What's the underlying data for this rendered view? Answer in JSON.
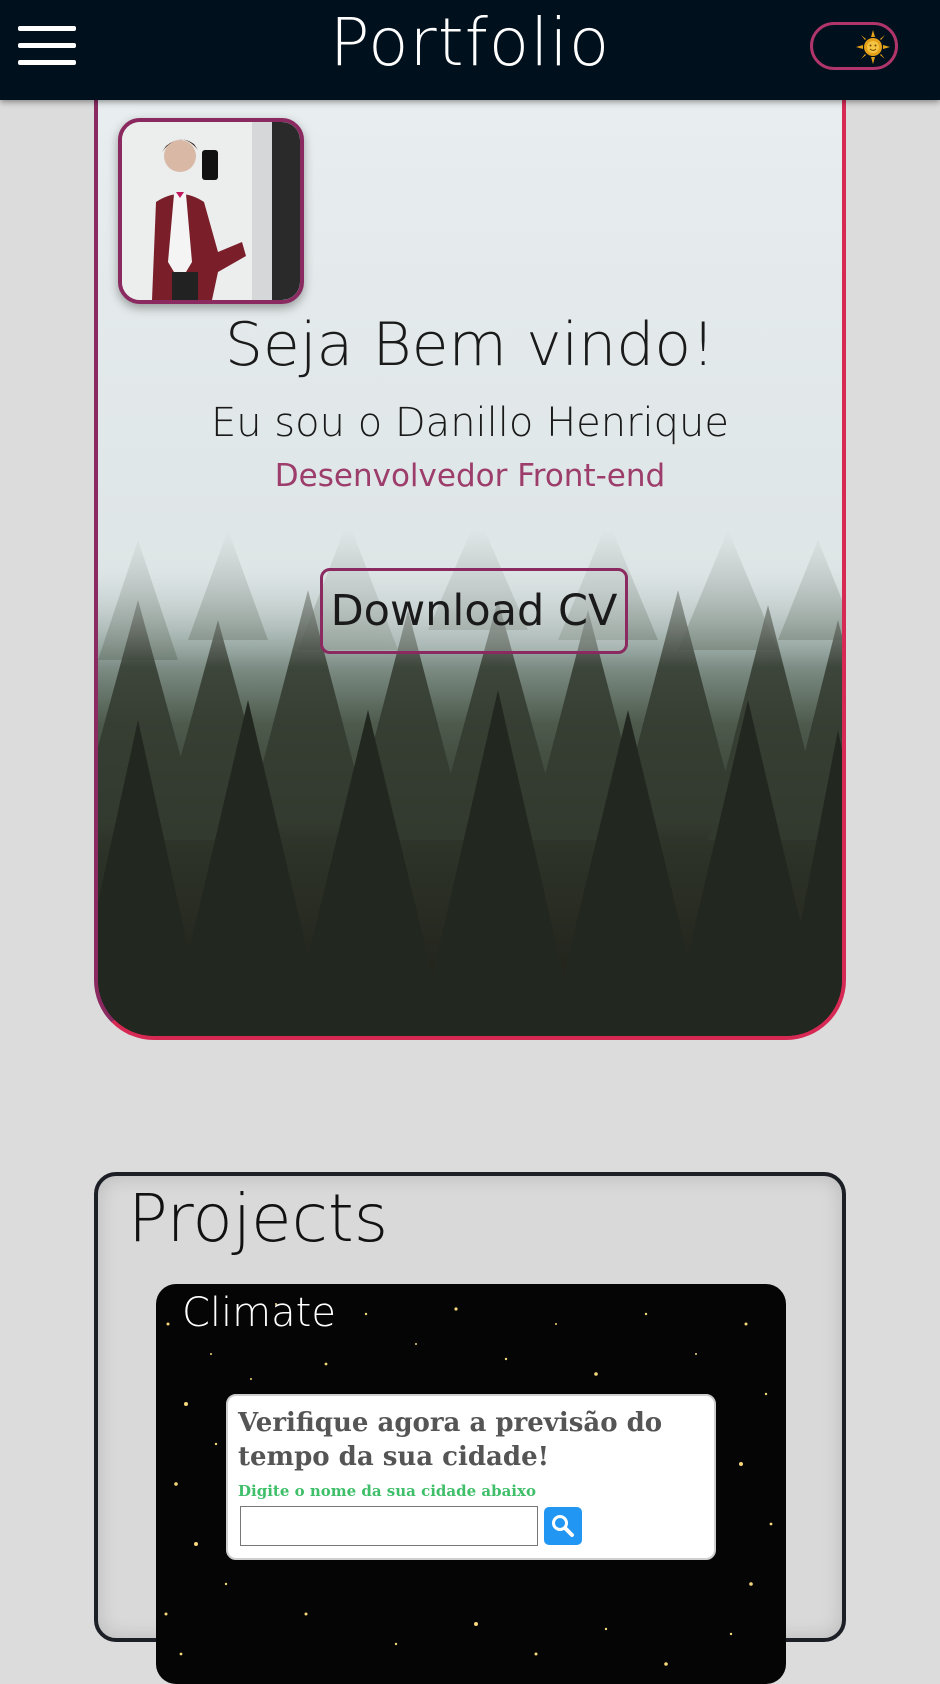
{
  "header": {
    "brand": "Portfolio",
    "menu_icon": "hamburger-menu-icon",
    "theme_icon": "sun-icon"
  },
  "hero": {
    "title": "Seja Bem vindo!",
    "name": "Eu sou o Danillo Henrique",
    "role": "Desenvolvedor Front-end",
    "cv_button": "Download CV"
  },
  "projects": {
    "title": "Projects",
    "cards": [
      {
        "title": "Climate",
        "heading": "Verifique agora a previsão do tempo da sua cidade!",
        "hint": "Digite o nome da sua cidade abaixo",
        "input_value": "",
        "search_icon": "search-icon"
      }
    ]
  },
  "colors": {
    "header_bg": "#01101d",
    "accent": "#8a2a60",
    "hero_border": "#d62a55",
    "hint_green": "#3fbf6a",
    "search_blue": "#2196f3"
  }
}
